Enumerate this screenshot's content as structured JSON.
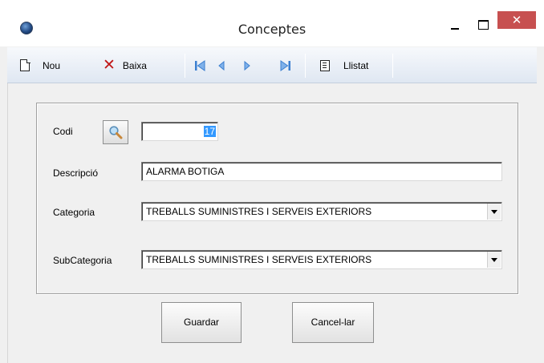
{
  "window": {
    "title": "Conceptes",
    "close_glyph": "✕"
  },
  "toolbar": {
    "new_label": "Nou",
    "delete_label": "Baixa",
    "list_label": "Llistat",
    "icons": [
      "new-doc-icon",
      "delete-x-icon",
      "first-record-icon",
      "previous-record-icon",
      "next-record-icon",
      "last-record-icon",
      "list-report-icon"
    ]
  },
  "form": {
    "codi_label": "Codi",
    "codi_value": "17",
    "descripcio_label": "Descripció",
    "descripcio_value": "ALARMA BOTIGA",
    "categoria_label": "Categoria",
    "categoria_value": "TREBALLS SUMINISTRES I SERVEIS EXTERIORS",
    "subcategoria_label": "SubCategoria",
    "subcategoria_value": "TREBALLS SUMINISTRES I SERVEIS EXTERIORS"
  },
  "buttons": {
    "save_label": "Guardar",
    "cancel_label": "Cancel-lar"
  },
  "colors": {
    "close_button": "#c75050",
    "nav_arrows": "#3b7fd0",
    "delete_icon": "#c01818",
    "selection": "#3399ff"
  }
}
